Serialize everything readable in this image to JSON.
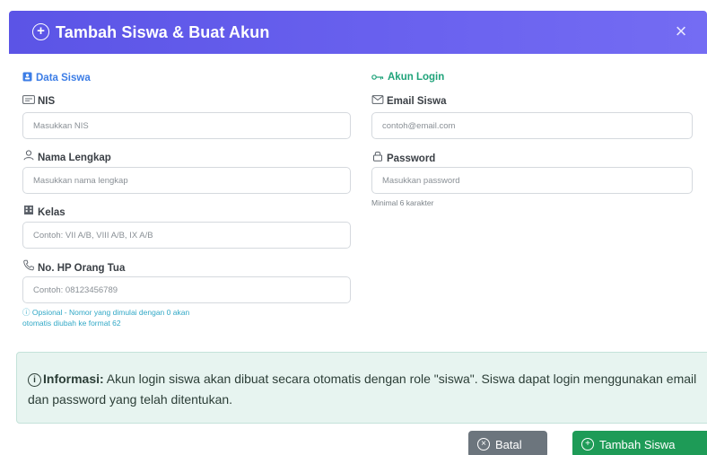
{
  "modal": {
    "title": "Tambah Siswa & Buat Akun",
    "close_symbol": "×"
  },
  "sections": {
    "data_siswa": "Data Siswa",
    "akun_login": "Akun Login"
  },
  "fields": {
    "nis": {
      "label": "NIS",
      "placeholder": "Masukkan NIS",
      "value": ""
    },
    "nama": {
      "label": "Nama Lengkap",
      "placeholder": "Masukkan nama lengkap",
      "value": ""
    },
    "kelas": {
      "label": "Kelas",
      "placeholder": "Contoh: VII A/B, VIII A/B, IX A/B",
      "value": ""
    },
    "hp": {
      "label": "No. HP Orang Tua",
      "placeholder": "Contoh: 08123456789",
      "value": "",
      "help_line1": "Opsional - Nomor yang dimulai dengan 0 akan",
      "help_line2": "otomatis diubah ke format 62"
    },
    "email": {
      "label": "Email Siswa",
      "placeholder": "contoh@email.com",
      "value": ""
    },
    "password": {
      "label": "Password",
      "placeholder": "Masukkan password",
      "value": "",
      "help": "Minimal 6 karakter"
    }
  },
  "info": {
    "bold": "Informasi:",
    "text": " Akun login siswa akan dibuat secara otomatis dengan role \"siswa\". Siswa dapat login menggunakan email dan password yang telah ditentukan."
  },
  "buttons": {
    "cancel": "Batal",
    "submit": "Tambah Siswa"
  },
  "icons": {
    "title": "plus-circle-icon",
    "close": "close-icon",
    "data_siswa": "id-card-icon",
    "akun_login": "key-icon",
    "nis": "card-icon",
    "nama": "person-icon",
    "kelas": "building-icon",
    "hp": "phone-icon",
    "email": "envelope-icon",
    "password": "lock-icon",
    "info": "info-circle-icon",
    "cancel": "x-circle-icon",
    "submit": "plus-circle-icon"
  },
  "colors": {
    "header": "#5b54e6",
    "data_siswa": "#3c7de6",
    "akun_login": "#1fa37a",
    "info_bg": "#e7f4f0",
    "btn_cancel": "#6c757d",
    "btn_submit": "#1e9b57"
  }
}
